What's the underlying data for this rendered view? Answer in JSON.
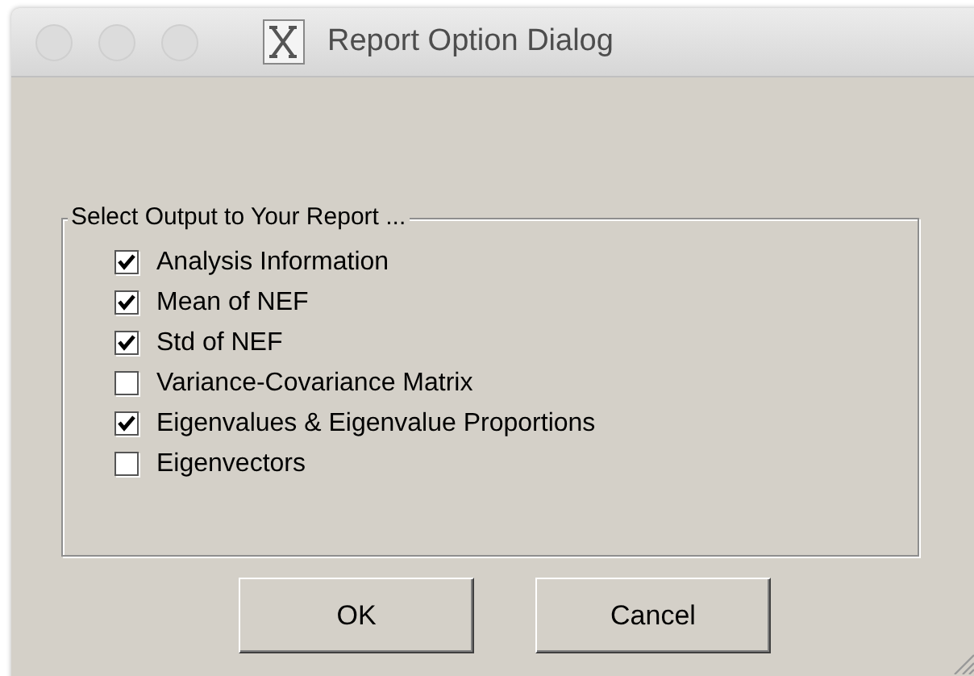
{
  "window": {
    "title": "Report Option Dialog"
  },
  "group": {
    "title": "Select Output to Your Report ...",
    "options": [
      {
        "label": "Analysis Information",
        "checked": true
      },
      {
        "label": "Mean of NEF",
        "checked": true
      },
      {
        "label": "Std of NEF",
        "checked": true
      },
      {
        "label": "Variance-Covariance Matrix",
        "checked": false
      },
      {
        "label": "Eigenvalues & Eigenvalue Proportions",
        "checked": true
      },
      {
        "label": "Eigenvectors",
        "checked": false
      }
    ]
  },
  "buttons": [
    {
      "label": "OK"
    },
    {
      "label": "Cancel"
    }
  ]
}
